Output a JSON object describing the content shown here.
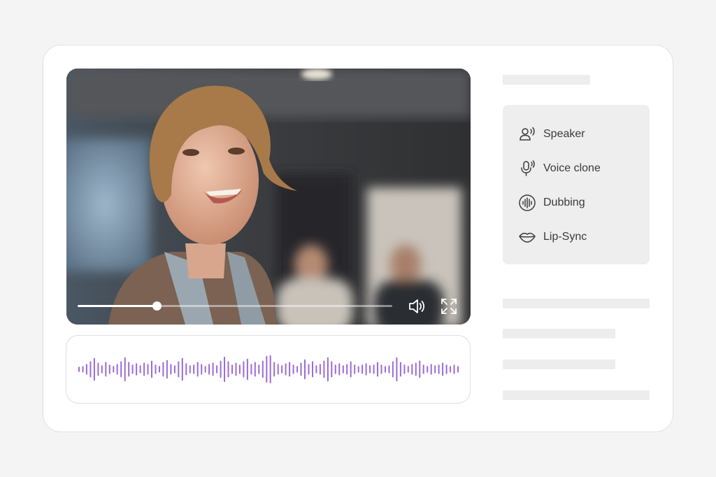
{
  "video": {
    "progress": 0.25,
    "volume_icon": "volume-icon",
    "fullscreen_icon": "fullscreen-icon"
  },
  "menu": {
    "items": [
      {
        "label": "Speaker",
        "icon": "speaker-person-icon"
      },
      {
        "label": "Voice clone",
        "icon": "microphone-icon"
      },
      {
        "label": "Dubbing",
        "icon": "sound-wave-icon"
      },
      {
        "label": "Lip-Sync",
        "icon": "lips-icon"
      }
    ]
  },
  "waveform": {
    "color": "#9b6bd6",
    "levels": [
      0.15,
      0.2,
      0.35,
      0.55,
      0.8,
      0.45,
      0.25,
      0.5,
      0.3,
      0.2,
      0.35,
      0.55,
      0.85,
      0.5,
      0.3,
      0.4,
      0.25,
      0.45,
      0.35,
      0.6,
      0.3,
      0.2,
      0.5,
      0.65,
      0.35,
      0.25,
      0.55,
      0.8,
      0.4,
      0.25,
      0.3,
      0.5,
      0.35,
      0.2,
      0.35,
      0.45,
      0.25,
      0.6,
      0.9,
      0.55,
      0.3,
      0.45,
      0.3,
      0.55,
      0.75,
      0.35,
      0.5,
      0.3,
      0.6,
      0.95,
      1.0,
      0.5,
      0.35,
      0.25,
      0.4,
      0.5,
      0.3,
      0.2,
      0.45,
      0.7,
      0.35,
      0.55,
      0.25,
      0.35,
      0.6,
      0.85,
      0.55,
      0.3,
      0.4,
      0.25,
      0.35,
      0.55,
      0.3,
      0.2,
      0.3,
      0.4,
      0.25,
      0.3,
      0.5,
      0.3,
      0.2,
      0.25,
      0.55,
      0.85,
      0.5,
      0.3,
      0.2,
      0.35,
      0.45,
      0.6,
      0.3,
      0.2,
      0.35,
      0.25,
      0.3,
      0.45,
      0.3,
      0.2,
      0.3,
      0.2
    ],
    "accent": "#9b6bd6"
  },
  "colors": {
    "page_bg": "#f4f4f5",
    "card_bg": "#ffffff",
    "panel_bg": "#eeeeef",
    "skeleton": "#ededee"
  }
}
